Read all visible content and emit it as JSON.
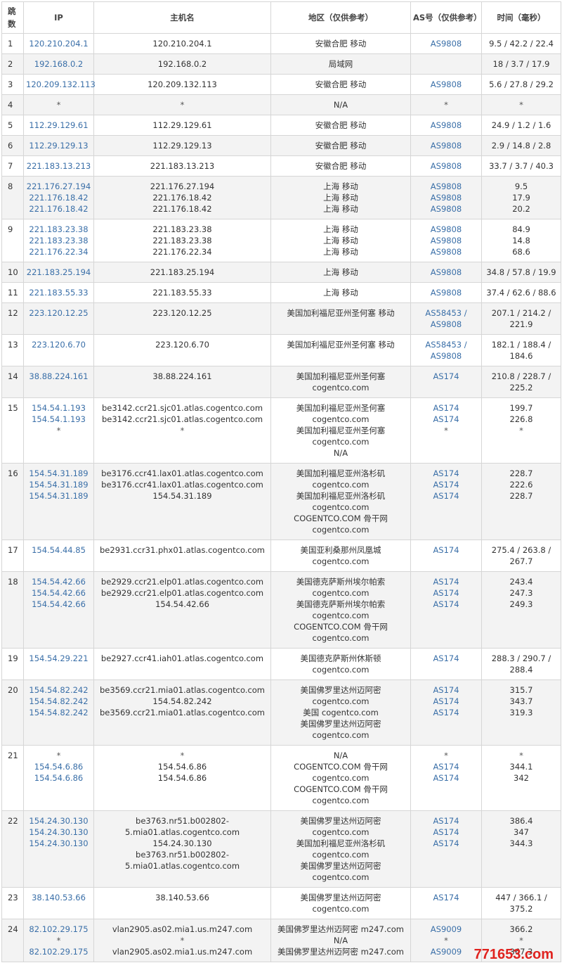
{
  "header": {
    "hop": "跳数",
    "ip": "IP",
    "host": "主机名",
    "region": "地区（仅供参考）",
    "asn": "AS号（仅供参考）",
    "time": "时间（毫秒）"
  },
  "rows": [
    {
      "hop": "1",
      "ip": [
        "120.210.204.1"
      ],
      "host": [
        "120.210.204.1"
      ],
      "region": [
        "安徽合肥 移动"
      ],
      "asn": [
        "AS9808"
      ],
      "time": [
        "9.5 / 42.2 / 22.4"
      ]
    },
    {
      "hop": "2",
      "ip": [
        "192.168.0.2"
      ],
      "host": [
        "192.168.0.2"
      ],
      "region": [
        "局域网"
      ],
      "asn": [
        ""
      ],
      "time": [
        "18 / 3.7 / 17.9"
      ]
    },
    {
      "hop": "3",
      "ip": [
        "120.209.132.113"
      ],
      "host": [
        "120.209.132.113"
      ],
      "region": [
        "安徽合肥 移动"
      ],
      "asn": [
        "AS9808"
      ],
      "time": [
        "5.6 / 27.8 / 29.2"
      ]
    },
    {
      "hop": "4",
      "ip": [
        "*"
      ],
      "host": [
        "*"
      ],
      "region": [
        "N/A"
      ],
      "asn": [
        "*"
      ],
      "time": [
        "*"
      ]
    },
    {
      "hop": "5",
      "ip": [
        "112.29.129.61"
      ],
      "host": [
        "112.29.129.61"
      ],
      "region": [
        "安徽合肥 移动"
      ],
      "asn": [
        "AS9808"
      ],
      "time": [
        "24.9 / 1.2 / 1.6"
      ]
    },
    {
      "hop": "6",
      "ip": [
        "112.29.129.13"
      ],
      "host": [
        "112.29.129.13"
      ],
      "region": [
        "安徽合肥 移动"
      ],
      "asn": [
        "AS9808"
      ],
      "time": [
        "2.9 / 14.8 / 2.8"
      ]
    },
    {
      "hop": "7",
      "ip": [
        "221.183.13.213"
      ],
      "host": [
        "221.183.13.213"
      ],
      "region": [
        "安徽合肥 移动"
      ],
      "asn": [
        "AS9808"
      ],
      "time": [
        "33.7 / 3.7 / 40.3"
      ]
    },
    {
      "hop": "8",
      "ip": [
        "221.176.27.194",
        "221.176.18.42",
        "221.176.18.42"
      ],
      "host": [
        "221.176.27.194",
        "221.176.18.42",
        "221.176.18.42"
      ],
      "region": [
        "上海 移动",
        "上海 移动",
        "上海 移动"
      ],
      "asn": [
        "AS9808",
        "AS9808",
        "AS9808"
      ],
      "time": [
        "9.5",
        "17.9",
        "20.2"
      ]
    },
    {
      "hop": "9",
      "ip": [
        "221.183.23.38",
        "221.183.23.38",
        "221.176.22.34"
      ],
      "host": [
        "221.183.23.38",
        "221.183.23.38",
        "221.176.22.34"
      ],
      "region": [
        "上海 移动",
        "上海 移动",
        "上海 移动"
      ],
      "asn": [
        "AS9808",
        "AS9808",
        "AS9808"
      ],
      "time": [
        "84.9",
        "14.8",
        "68.6"
      ]
    },
    {
      "hop": "10",
      "ip": [
        "221.183.25.194"
      ],
      "host": [
        "221.183.25.194"
      ],
      "region": [
        "上海 移动"
      ],
      "asn": [
        "AS9808"
      ],
      "time": [
        "34.8 / 57.8 / 19.9"
      ]
    },
    {
      "hop": "11",
      "ip": [
        "221.183.55.33"
      ],
      "host": [
        "221.183.55.33"
      ],
      "region": [
        "上海 移动"
      ],
      "asn": [
        "AS9808"
      ],
      "time": [
        "37.4 / 62.6 / 88.6"
      ]
    },
    {
      "hop": "12",
      "ip": [
        "223.120.12.25"
      ],
      "host": [
        "223.120.12.25"
      ],
      "region": [
        "美国加利福尼亚州圣何塞 移动"
      ],
      "asn": [
        "AS58453 /",
        "AS9808"
      ],
      "time": [
        "207.1 / 214.2 /",
        "221.9"
      ]
    },
    {
      "hop": "13",
      "ip": [
        "223.120.6.70"
      ],
      "host": [
        "223.120.6.70"
      ],
      "region": [
        "美国加利福尼亚州圣何塞 移动"
      ],
      "asn": [
        "AS58453 /",
        "AS9808"
      ],
      "time": [
        "182.1 / 188.4 /",
        "184.6"
      ]
    },
    {
      "hop": "14",
      "ip": [
        "38.88.224.161"
      ],
      "host": [
        "38.88.224.161"
      ],
      "region": [
        "美国加利福尼亚州圣何塞",
        "cogentco.com"
      ],
      "asn": [
        "AS174"
      ],
      "time": [
        "210.8 / 228.7 /",
        "225.2"
      ]
    },
    {
      "hop": "15",
      "ip": [
        "154.54.1.193",
        "154.54.1.193",
        "*"
      ],
      "host": [
        "be3142.ccr21.sjc01.atlas.cogentco.com",
        "be3142.ccr21.sjc01.atlas.cogentco.com",
        "*"
      ],
      "region": [
        "美国加利福尼亚州圣何塞",
        "cogentco.com",
        "美国加利福尼亚州圣何塞",
        "cogentco.com",
        "N/A"
      ],
      "asn": [
        "AS174",
        "AS174",
        "*"
      ],
      "time": [
        "199.7",
        "226.8",
        "*"
      ]
    },
    {
      "hop": "16",
      "ip": [
        "154.54.31.189",
        "154.54.31.189",
        "154.54.31.189"
      ],
      "host": [
        "be3176.ccr41.lax01.atlas.cogentco.com",
        "be3176.ccr41.lax01.atlas.cogentco.com",
        "154.54.31.189"
      ],
      "region": [
        "美国加利福尼亚州洛杉矶",
        "cogentco.com",
        "美国加利福尼亚州洛杉矶",
        "cogentco.com",
        "COGENTCO.COM 骨干网",
        "cogentco.com"
      ],
      "asn": [
        "AS174",
        "AS174",
        "AS174"
      ],
      "time": [
        "228.7",
        "222.6",
        "228.7"
      ]
    },
    {
      "hop": "17",
      "ip": [
        "154.54.44.85"
      ],
      "host": [
        "be2931.ccr31.phx01.atlas.cogentco.com"
      ],
      "region": [
        "美国亚利桑那州凤凰城",
        "cogentco.com"
      ],
      "asn": [
        "AS174"
      ],
      "time": [
        "275.4 / 263.8 /",
        "267.7"
      ]
    },
    {
      "hop": "18",
      "ip": [
        "154.54.42.66",
        "154.54.42.66",
        "154.54.42.66"
      ],
      "host": [
        "be2929.ccr21.elp01.atlas.cogentco.com",
        "be2929.ccr21.elp01.atlas.cogentco.com",
        "154.54.42.66"
      ],
      "region": [
        "美国德克萨斯州埃尔帕索",
        "cogentco.com",
        "美国德克萨斯州埃尔帕索",
        "cogentco.com",
        "COGENTCO.COM 骨干网",
        "cogentco.com"
      ],
      "asn": [
        "AS174",
        "AS174",
        "AS174"
      ],
      "time": [
        "243.4",
        "247.3",
        "249.3"
      ]
    },
    {
      "hop": "19",
      "ip": [
        "154.54.29.221"
      ],
      "host": [
        "be2927.ccr41.iah01.atlas.cogentco.com"
      ],
      "region": [
        "美国德克萨斯州休斯顿",
        "cogentco.com"
      ],
      "asn": [
        "AS174"
      ],
      "time": [
        "288.3 / 290.7 /",
        "288.4"
      ]
    },
    {
      "hop": "20",
      "ip": [
        "154.54.82.242",
        "154.54.82.242",
        "154.54.82.242"
      ],
      "host": [
        "be3569.ccr21.mia01.atlas.cogentco.com",
        "154.54.82.242",
        "be3569.ccr21.mia01.atlas.cogentco.com"
      ],
      "region": [
        "美国佛罗里达州迈阿密",
        "cogentco.com",
        "美国 cogentco.com",
        "美国佛罗里达州迈阿密",
        "cogentco.com"
      ],
      "asn": [
        "AS174",
        "AS174",
        "AS174"
      ],
      "time": [
        "315.7",
        "343.7",
        "319.3"
      ]
    },
    {
      "hop": "21",
      "ip": [
        "*",
        "154.54.6.86",
        "154.54.6.86"
      ],
      "host": [
        "*",
        "154.54.6.86",
        "154.54.6.86"
      ],
      "region": [
        "N/A",
        "COGENTCO.COM 骨干网",
        "cogentco.com",
        "COGENTCO.COM 骨干网",
        "cogentco.com"
      ],
      "asn": [
        "*",
        "AS174",
        "AS174"
      ],
      "time": [
        "*",
        "344.1",
        "342"
      ]
    },
    {
      "hop": "22",
      "ip": [
        "154.24.30.130",
        "154.24.30.130",
        "154.24.30.130"
      ],
      "host": [
        "be3763.nr51.b002802-",
        "5.mia01.atlas.cogentco.com",
        "154.24.30.130",
        "be3763.nr51.b002802-",
        "5.mia01.atlas.cogentco.com"
      ],
      "region": [
        "美国佛罗里达州迈阿密",
        "cogentco.com",
        "美国加利福尼亚州洛杉矶",
        "cogentco.com",
        "美国佛罗里达州迈阿密",
        "cogentco.com"
      ],
      "asn": [
        "AS174",
        "AS174",
        "AS174"
      ],
      "time": [
        "386.4",
        "347",
        "344.3"
      ]
    },
    {
      "hop": "23",
      "ip": [
        "38.140.53.66"
      ],
      "host": [
        "38.140.53.66"
      ],
      "region": [
        "美国佛罗里达州迈阿密",
        "cogentco.com"
      ],
      "asn": [
        "AS174"
      ],
      "time": [
        "447 / 366.1 /",
        "375.2"
      ]
    },
    {
      "hop": "24",
      "ip": [
        "82.102.29.175",
        "*",
        "82.102.29.175"
      ],
      "host": [
        "vlan2905.as02.mia1.us.m247.com",
        "*",
        "vlan2905.as02.mia1.us.m247.com"
      ],
      "region": [
        "美国佛罗里达州迈阿密 m247.com",
        "N/A",
        "美国佛罗里达州迈阿密 m247.com"
      ],
      "asn": [
        "AS9009",
        "*",
        "AS9009"
      ],
      "time": [
        "366.2",
        "*",
        "367.3"
      ]
    }
  ],
  "watermark": "771653.com"
}
